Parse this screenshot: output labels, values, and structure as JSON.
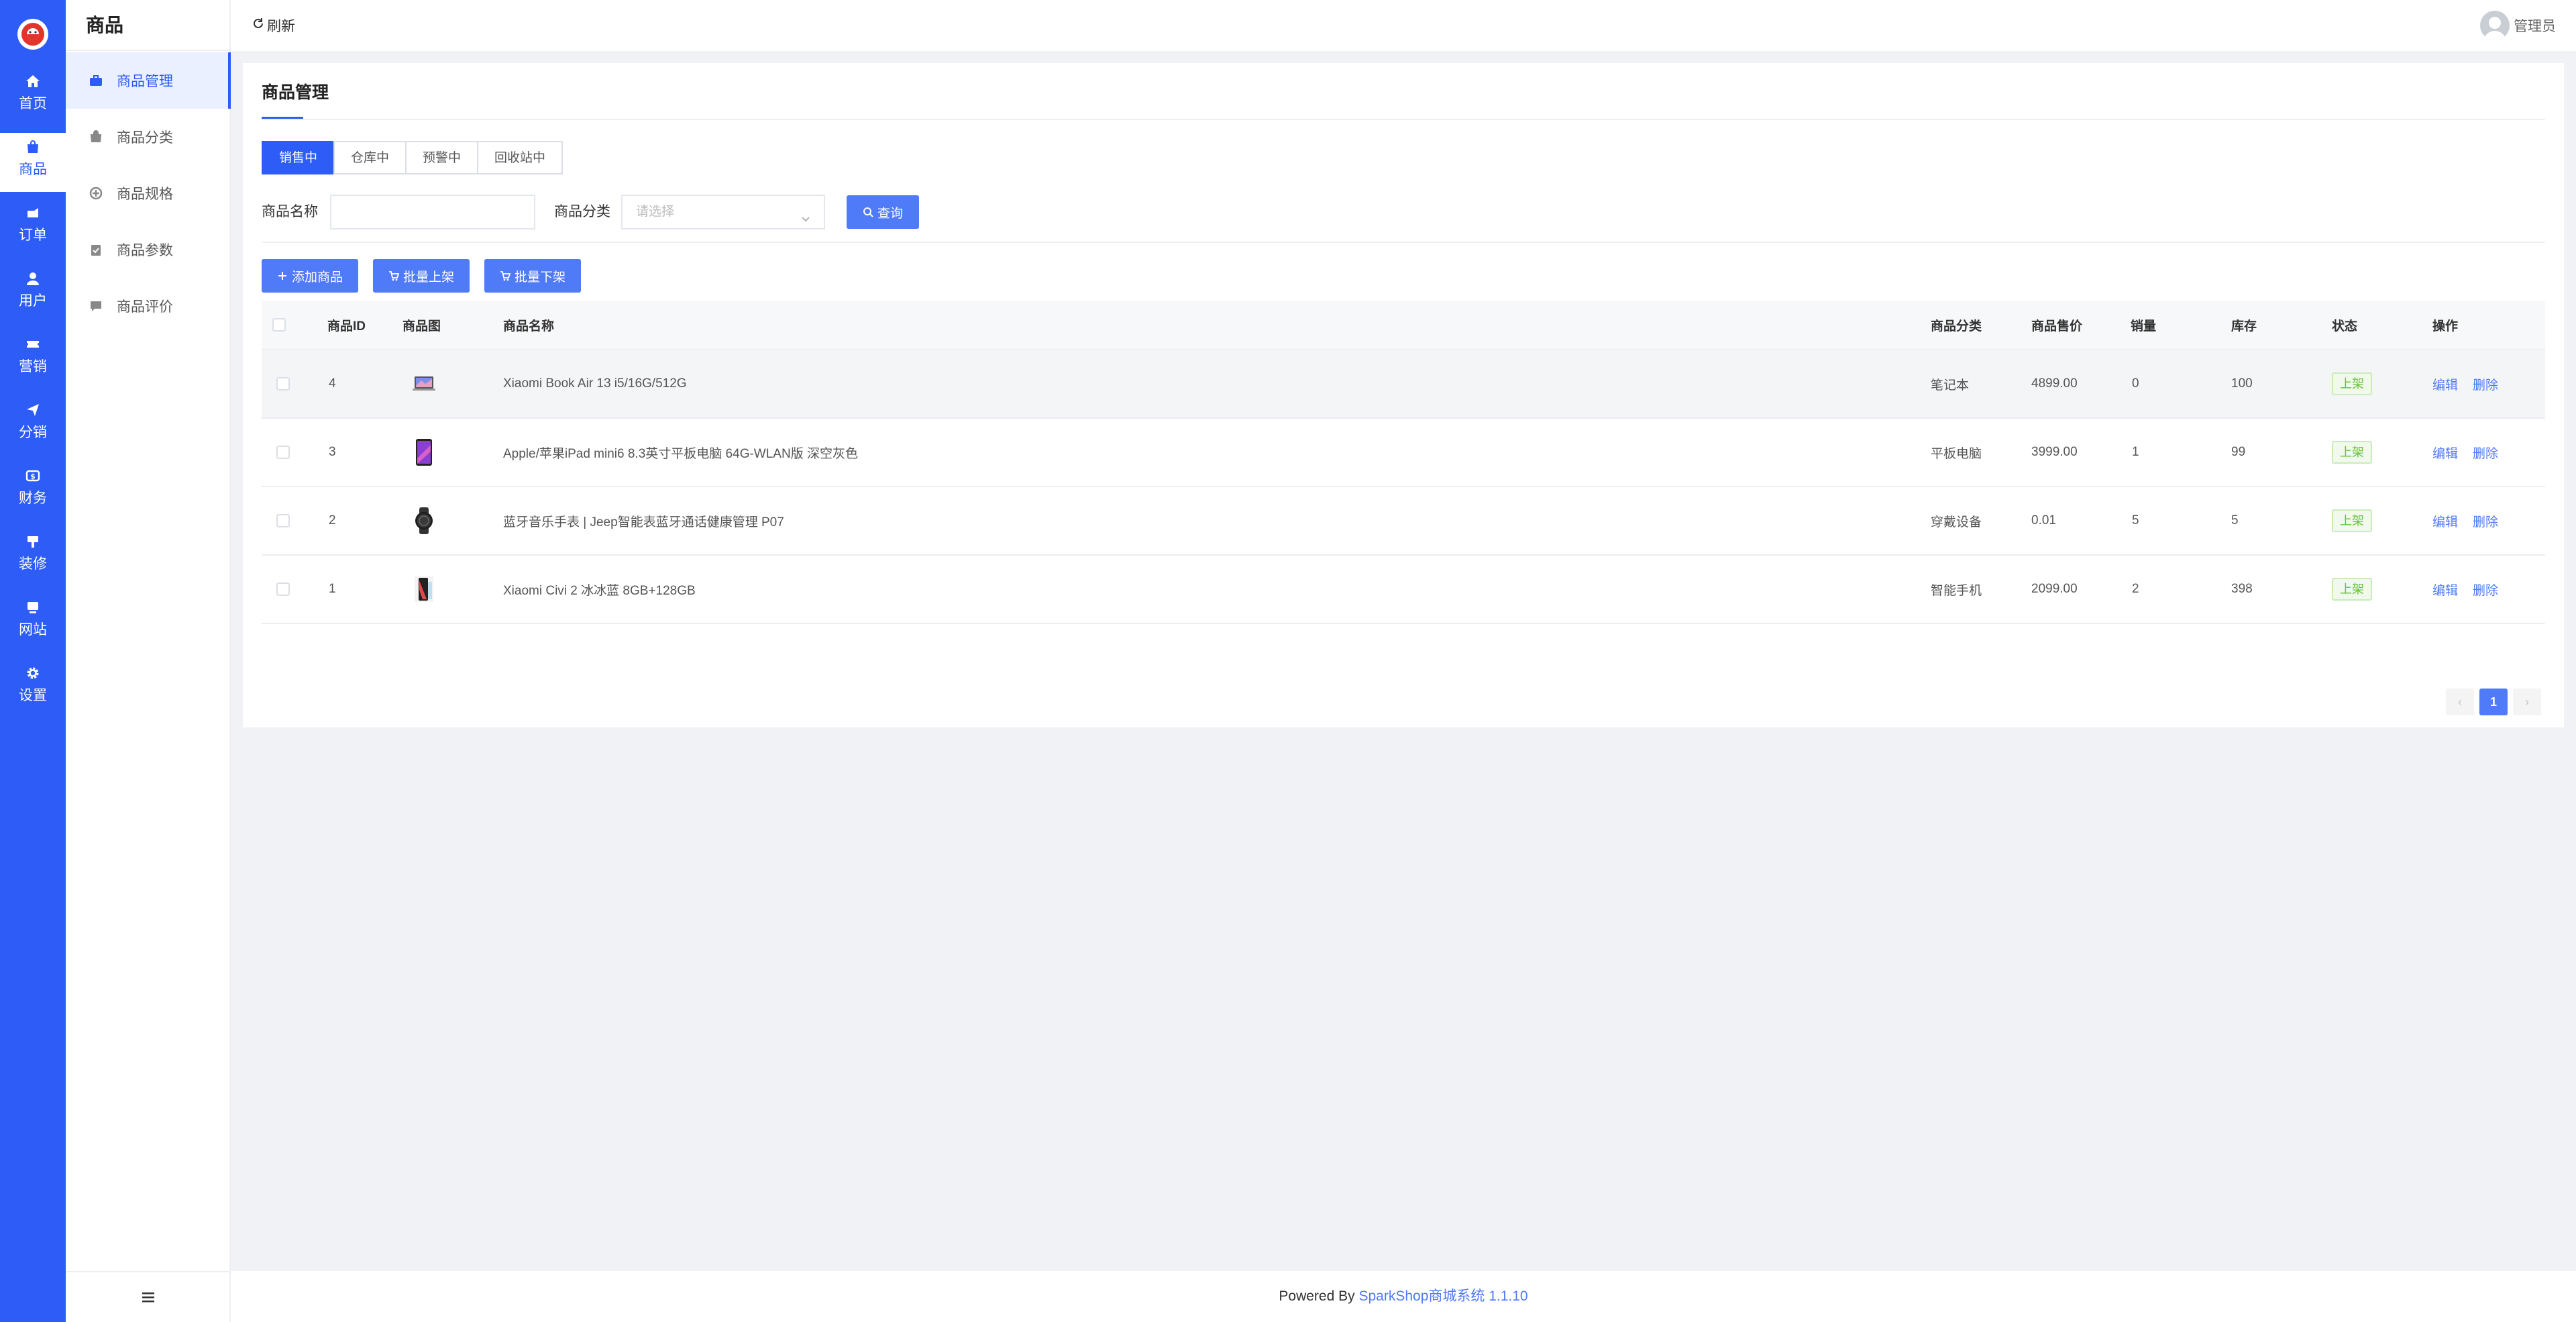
{
  "rail": {
    "items": [
      {
        "label": "首页",
        "icon": "home-icon"
      },
      {
        "label": "商品",
        "icon": "bag-icon"
      },
      {
        "label": "订单",
        "icon": "order-icon"
      },
      {
        "label": "用户",
        "icon": "user-icon"
      },
      {
        "label": "营销",
        "icon": "ticket-icon"
      },
      {
        "label": "分销",
        "icon": "send-icon"
      },
      {
        "label": "财务",
        "icon": "money-icon"
      },
      {
        "label": "装修",
        "icon": "brush-icon"
      },
      {
        "label": "网站",
        "icon": "monitor-icon"
      },
      {
        "label": "设置",
        "icon": "gear-icon"
      }
    ],
    "active_index": 1
  },
  "subnav": {
    "title": "商品",
    "items": [
      {
        "label": "商品管理",
        "icon": "briefcase-icon"
      },
      {
        "label": "商品分类",
        "icon": "bag-icon"
      },
      {
        "label": "商品规格",
        "icon": "spec-icon"
      },
      {
        "label": "商品参数",
        "icon": "clipboard-icon"
      },
      {
        "label": "商品评价",
        "icon": "comment-icon"
      }
    ],
    "active_index": 0
  },
  "topbar": {
    "refresh_label": "刷新",
    "user_name": "管理员"
  },
  "page": {
    "title": "商品管理",
    "tabs": [
      "销售中",
      "仓库中",
      "预警中",
      "回收站中"
    ],
    "active_tab": 0,
    "search": {
      "name_label": "商品名称",
      "name_value": "",
      "category_label": "商品分类",
      "category_placeholder": "请选择",
      "query_button": "查询"
    },
    "actions": {
      "add": "添加商品",
      "batch_on": "批量上架",
      "batch_off": "批量下架"
    },
    "table": {
      "headers": {
        "id": "商品ID",
        "image": "商品图",
        "name": "商品名称",
        "category": "商品分类",
        "price": "商品售价",
        "sales": "销量",
        "stock": "库存",
        "status": "状态",
        "ops": "操作"
      },
      "rows": [
        {
          "id": "4",
          "thumb": "laptop",
          "name": "Xiaomi Book Air 13 i5/16G/512G",
          "category": "笔记本",
          "price": "4899.00",
          "sales": "0",
          "stock": "100",
          "status": "上架",
          "edit": "编辑",
          "delete": "删除"
        },
        {
          "id": "3",
          "thumb": "tablet",
          "name": "Apple/苹果iPad mini6 8.3英寸平板电脑 64G-WLAN版 深空灰色",
          "category": "平板电脑",
          "price": "3999.00",
          "sales": "1",
          "stock": "99",
          "status": "上架",
          "edit": "编辑",
          "delete": "删除"
        },
        {
          "id": "2",
          "thumb": "watch",
          "name": "蓝牙音乐手表 | Jeep智能表蓝牙通话健康管理 P07",
          "category": "穿戴设备",
          "price": "0.01",
          "sales": "5",
          "stock": "5",
          "status": "上架",
          "edit": "编辑",
          "delete": "删除"
        },
        {
          "id": "1",
          "thumb": "phone",
          "name": "Xiaomi Civi 2 冰冰蓝 8GB+128GB",
          "category": "智能手机",
          "price": "2099.00",
          "sales": "2",
          "stock": "398",
          "status": "上架",
          "edit": "编辑",
          "delete": "删除"
        }
      ]
    },
    "pagination": {
      "prev": "‹",
      "current": "1",
      "next": "›"
    }
  },
  "footer": {
    "prefix": "Powered By ",
    "brand": "SparkShop商城系统 1.1.10"
  },
  "colors": {
    "primary": "#2d5cf6",
    "button": "#4f7af8",
    "success": "#67c23a"
  }
}
